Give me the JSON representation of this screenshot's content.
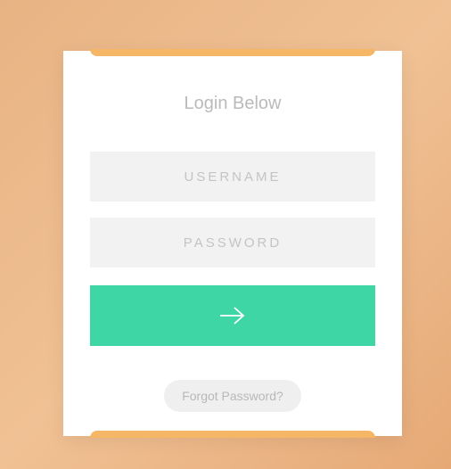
{
  "form": {
    "title": "Login Below",
    "username_placeholder": "USERNAME",
    "password_placeholder": "PASSWORD",
    "forgot_label": "Forgot Password?"
  },
  "colors": {
    "accent": "#3ed6a4",
    "bar": "#f5b666"
  }
}
